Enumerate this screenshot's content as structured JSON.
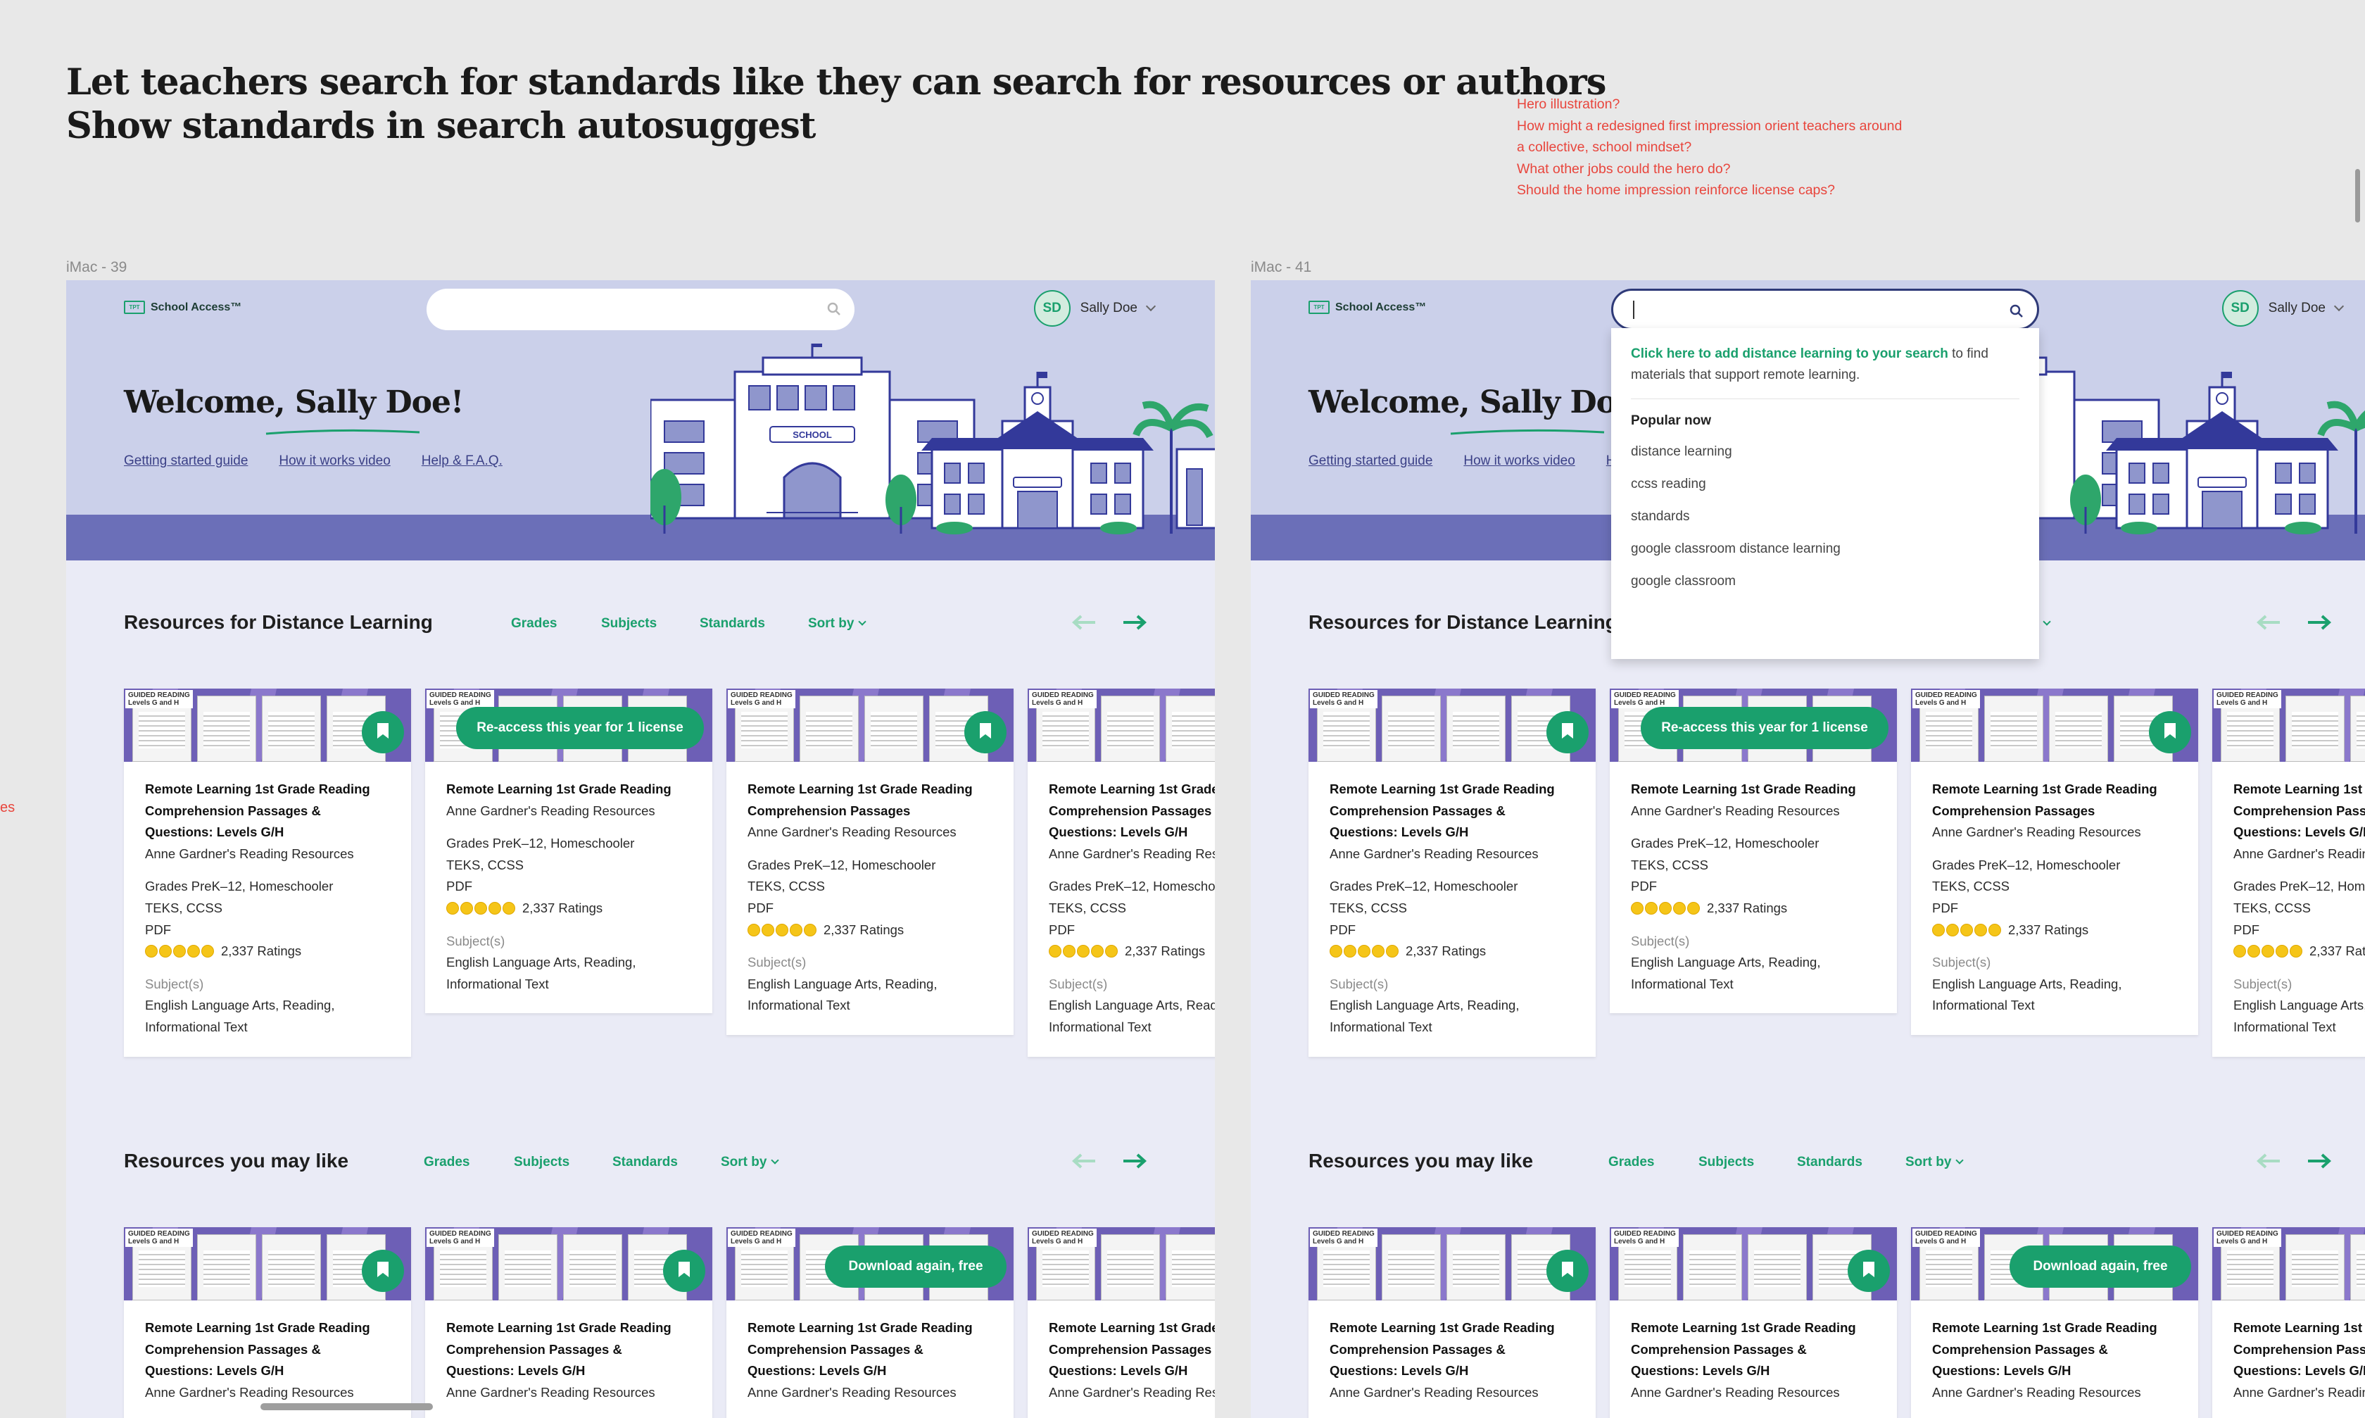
{
  "canvas": {
    "heading_lines": [
      "Let teachers search for standards like they can search for resources or authors",
      "Show standards in search autosuggest"
    ],
    "notes": [
      "Hero illustration?",
      "How might a redesigned first impression orient teachers around",
      "a collective, school mindset?",
      "What other jobs could the hero do?",
      "Should the home impression reinforce license caps?"
    ],
    "side_note": "es"
  },
  "frames": [
    {
      "label": "iMac - 39"
    },
    {
      "label": "iMac - 41"
    }
  ],
  "header": {
    "logo_mark": "TPT",
    "logo_text": "School Access™",
    "user_initials": "SD",
    "user_name": "Sally Doe"
  },
  "hero": {
    "welcome": "Welcome, Sally Doe!",
    "links": [
      "Getting started guide",
      "How it works video",
      "Help & F.A.Q."
    ],
    "sign_text": "SCHOOL"
  },
  "search_dropdown": {
    "hint_link": "Click here to add distance learning to your search",
    "hint_rest": " to find materials that support remote learning.",
    "popular_label": "Popular now",
    "items": [
      "distance learning",
      "ccss reading",
      "standards",
      "google classroom distance learning",
      "google classroom"
    ]
  },
  "filters": {
    "grades": "Grades",
    "subjects": "Subjects",
    "standards": "Standards",
    "sort": "Sort by"
  },
  "sections": [
    {
      "title": "Resources for Distance Learning"
    },
    {
      "title": "Resources you may like"
    }
  ],
  "card_common": {
    "thumb_tag": "GUIDED READING Levels G and H",
    "title_long": "Remote Learning 1st Grade Reading Comprehension Passages & Questions: Levels G/H",
    "title_short": "Remote Learning 1st Grade Reading",
    "title_mid": "Remote Learning 1st Grade Reading Comprehension Passages",
    "author": "Anne Gardner's Reading Resources",
    "grades": "Grades PreK–12, Homeschooler",
    "standards": "TEKS, CCSS",
    "format": "PDF",
    "ratings": "2,337 Ratings",
    "rating_stars": 5,
    "subjects_label": "Subject(s)",
    "subjects": "English Language Arts, Reading, Informational Text"
  },
  "actions": {
    "reaccess": "Re-access this year for 1 license",
    "download": "Download again, free"
  }
}
